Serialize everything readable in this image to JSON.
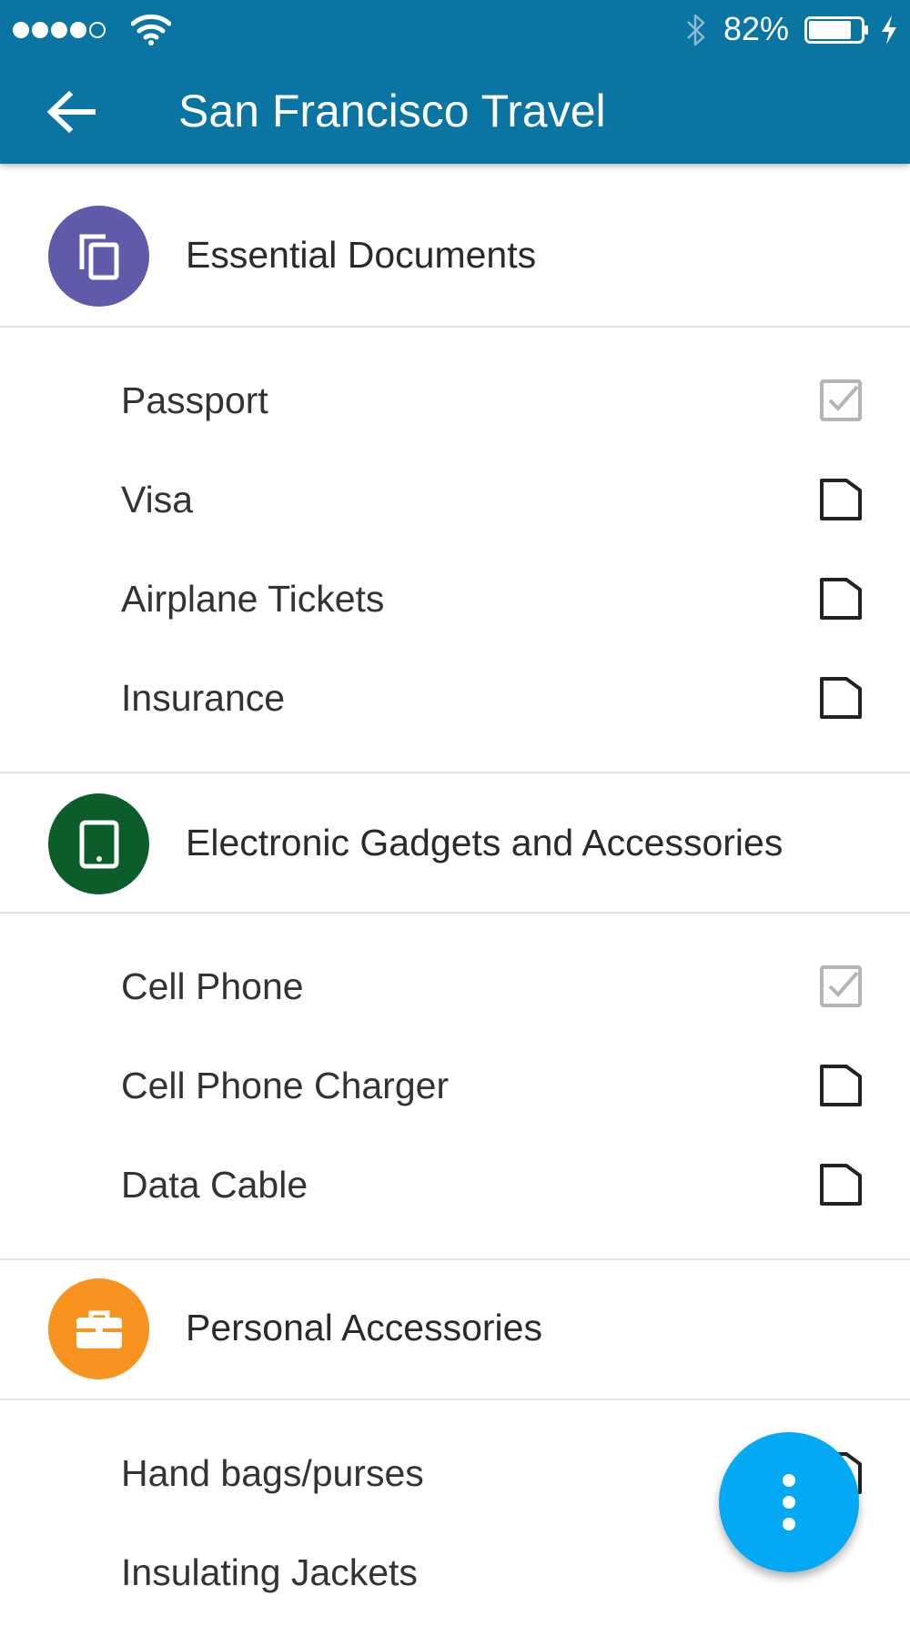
{
  "status_bar": {
    "signal_bars_filled": 4,
    "signal_bars_total": 5,
    "battery_percent": "82%",
    "battery_level": 0.82,
    "charging": true,
    "icons": [
      "signal-dots-icon",
      "wifi-icon",
      "bluetooth-icon",
      "battery-icon",
      "charging-bolt-icon"
    ]
  },
  "header": {
    "title": "San Francisco Travel",
    "back_icon": "arrow-left-icon",
    "background_color": "#0a74a3"
  },
  "categories": [
    {
      "title": "Essential Documents",
      "icon": "documents-copy-icon",
      "icon_color": "#5f5aa9",
      "items": [
        {
          "label": "Passport",
          "checked": true
        },
        {
          "label": "Visa",
          "checked": false
        },
        {
          "label": "Airplane Tickets",
          "checked": false
        },
        {
          "label": "Insurance",
          "checked": false
        }
      ]
    },
    {
      "title": "Electronic Gadgets and Accessories",
      "icon": "tablet-icon",
      "icon_color": "#0b5d2a",
      "items": [
        {
          "label": "Cell Phone",
          "checked": true
        },
        {
          "label": "Cell Phone Charger",
          "checked": false
        },
        {
          "label": "Data Cable",
          "checked": false
        }
      ]
    },
    {
      "title": "Personal Accessories",
      "icon": "briefcase-icon",
      "icon_color": "#f7931e",
      "items": [
        {
          "label": "Hand bags/purses",
          "checked": false
        },
        {
          "label": "Insulating Jackets",
          "checked": false
        }
      ]
    }
  ],
  "fab": {
    "icon": "more-vertical-icon",
    "color": "#03a9f4"
  }
}
